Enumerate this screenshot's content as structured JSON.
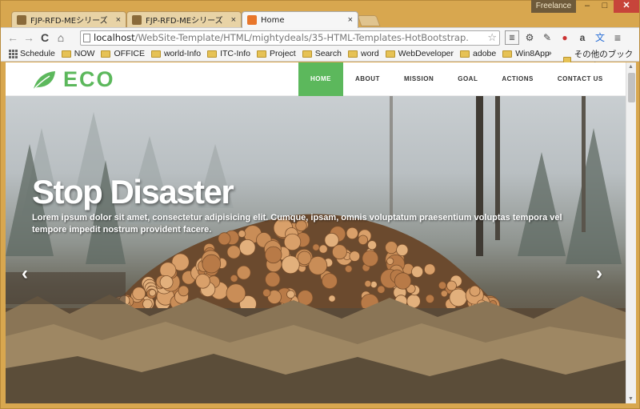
{
  "browser": {
    "tabs": [
      {
        "title": "FJP-RFD-MEシリーズ【従",
        "close": "×",
        "active": false
      },
      {
        "title": "FJP-RFD-MEシリーズ【従",
        "close": "×",
        "active": false
      },
      {
        "title": "Home",
        "close": "×",
        "active": true
      }
    ],
    "profile_label": "Freelance",
    "window_buttons": {
      "minimize": "–",
      "maximize": "□",
      "close": "✕"
    },
    "nav": {
      "back": "←",
      "forward": "→",
      "reload": "C",
      "home": "⌂"
    },
    "address": {
      "host": "localhost",
      "path": "/WebSite-Template/HTML/mightydeals/35-HTML-Templates-HotBootstrap.",
      "star": "☆"
    },
    "toolbar_icons": [
      "extension-icon",
      "gear-icon",
      "extension-icon",
      "extension-icon",
      "amazon-icon",
      "translate-icon",
      "menu-icon"
    ],
    "bookmarks": [
      {
        "label": "Schedule",
        "icon": "apps-icon"
      },
      {
        "label": "NOW",
        "icon": "folder-icon"
      },
      {
        "label": "OFFICE",
        "icon": "folder-icon"
      },
      {
        "label": "world-Info",
        "icon": "folder-icon"
      },
      {
        "label": "ITC-Info",
        "icon": "folder-icon"
      },
      {
        "label": "Project",
        "icon": "folder-icon"
      },
      {
        "label": "Search",
        "icon": "folder-icon"
      },
      {
        "label": "word",
        "icon": "folder-icon"
      },
      {
        "label": "WebDeveloper",
        "icon": "folder-icon"
      },
      {
        "label": "adobe",
        "icon": "folder-icon"
      },
      {
        "label": "Win8App",
        "icon": "folder-icon"
      }
    ],
    "bookmarks_more": "»",
    "other_bookmarks": "その他のブックマーク"
  },
  "site": {
    "logo_text": "ECO",
    "menu": [
      {
        "label": "HOME",
        "active": true
      },
      {
        "label": "ABOUT",
        "active": false
      },
      {
        "label": "MISSION",
        "active": false
      },
      {
        "label": "GOAL",
        "active": false
      },
      {
        "label": "ACTIONS",
        "active": false
      },
      {
        "label": "CONTACT US",
        "active": false
      }
    ],
    "hero": {
      "title": "Stop Disaster",
      "text": "Lorem ipsum dolor sit amet, consectetur adipisicing elit. Cumque, ipsam, omnis voluptatum praesentium voluptas tempora vel tempore impedit nostrum provident facere.",
      "prev": "‹",
      "next": "›"
    }
  },
  "colors": {
    "accent": "#5cb85c",
    "frame": "#d8a74f",
    "close": "#c7443a"
  }
}
